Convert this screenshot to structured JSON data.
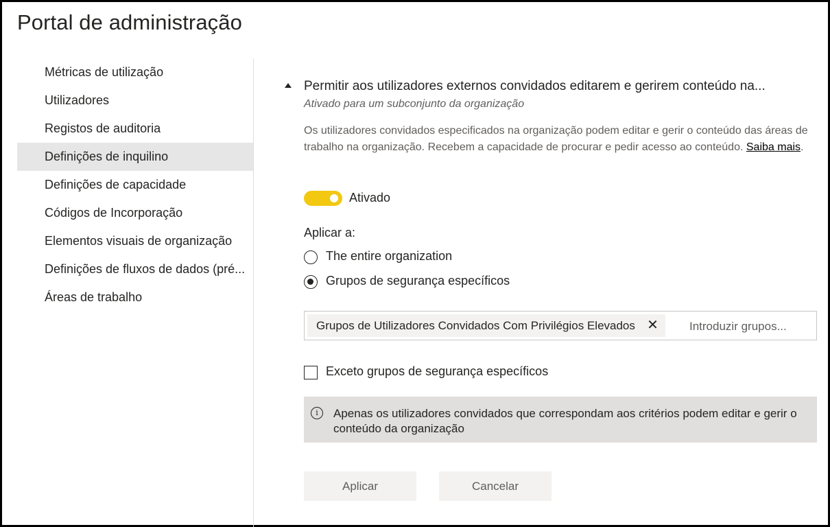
{
  "page_title": "Portal de administração",
  "sidebar": {
    "items": [
      {
        "label": "Métricas de utilização"
      },
      {
        "label": "Utilizadores"
      },
      {
        "label": "Registos de auditoria"
      },
      {
        "label": "Definições de inquilino"
      },
      {
        "label": "Definições de capacidade"
      },
      {
        "label": "Códigos de Incorporação"
      },
      {
        "label": "Elementos visuais de organização"
      },
      {
        "label": "Definições de fluxos de dados (pré..."
      },
      {
        "label": "Áreas de trabalho"
      }
    ],
    "selected_index": 3
  },
  "setting": {
    "title": "Permitir aos utilizadores externos convidados editarem e gerirem conteúdo na...",
    "status": "Ativado para um subconjunto da organização",
    "description": "Os utilizadores convidados especificados na organização podem editar e gerir o conteúdo das áreas de trabalho na organização. Recebem a capacidade de procurar e pedir acesso ao conteúdo. ",
    "learn_more": "Saiba mais",
    "learn_more_suffix": ".",
    "toggle_label": "Ativado",
    "toggle_on": true,
    "apply_to_label": "Aplicar a:",
    "radio_entire_org": "The entire organization",
    "radio_specific_groups": "Grupos de segurança específicos",
    "selected_radio": "specific_groups",
    "group_chip": "Grupos de Utilizadores Convidados Com Privilégios Elevados",
    "chip_close_symbol": "✕",
    "group_placeholder": "Introduzir grupos...",
    "except_label": "Exceto grupos de segurança específicos",
    "except_checked": false,
    "info_symbol": "i",
    "info_text": "Apenas os utilizadores convidados que correspondam aos critérios podem editar e gerir o conteúdo da organização",
    "apply_button": "Aplicar",
    "cancel_button": "Cancelar"
  },
  "colors": {
    "toggle_on": "#f2c811",
    "selected_nav_bg": "#e6e6e6",
    "info_box_bg": "#e1dfdd",
    "button_bg": "#f3f2f1"
  }
}
